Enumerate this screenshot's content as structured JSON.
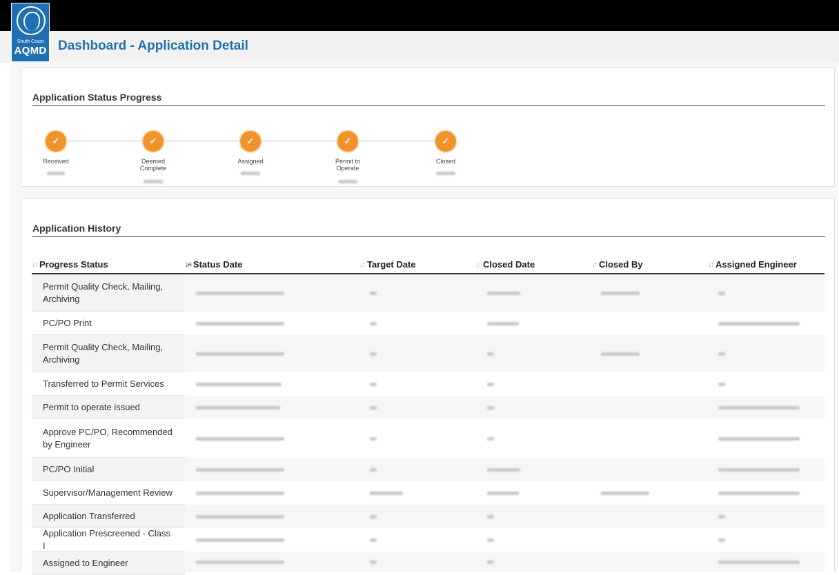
{
  "header": {
    "logo_small": "South Coast",
    "logo_big": "AQMD",
    "page_title": "Dashboard - Application Detail"
  },
  "progress": {
    "title": "Application Status Progress",
    "steps": [
      {
        "label": "Received"
      },
      {
        "label": "Deemed Complete"
      },
      {
        "label": "Assigned"
      },
      {
        "label": "Permit to Operate"
      },
      {
        "label": "Closed"
      }
    ]
  },
  "history": {
    "title": "Application History",
    "columns": [
      "Progress Status",
      "Status Date",
      "Target Date",
      "Closed Date",
      "Closed By",
      "Assigned Engineer"
    ],
    "rows": [
      {
        "status": "Permit Quality Check, Mailing, Archiving"
      },
      {
        "status": "PC/PO Print"
      },
      {
        "status": "Permit Quality Check, Mailing, Archiving"
      },
      {
        "status": "Transferred to Permit Services"
      },
      {
        "status": "Permit to operate issued"
      },
      {
        "status": "Approve PC/PO, Recommended by Engineer"
      },
      {
        "status": "PC/PO Initial"
      },
      {
        "status": "Supervisor/Management Review"
      },
      {
        "status": "Application Transferred"
      },
      {
        "status": "Application Prescreened - Class I"
      },
      {
        "status": "Assigned to Engineer"
      }
    ]
  },
  "colors": {
    "brand_blue": "#1f6fb2",
    "step_orange": "#f0932b"
  }
}
